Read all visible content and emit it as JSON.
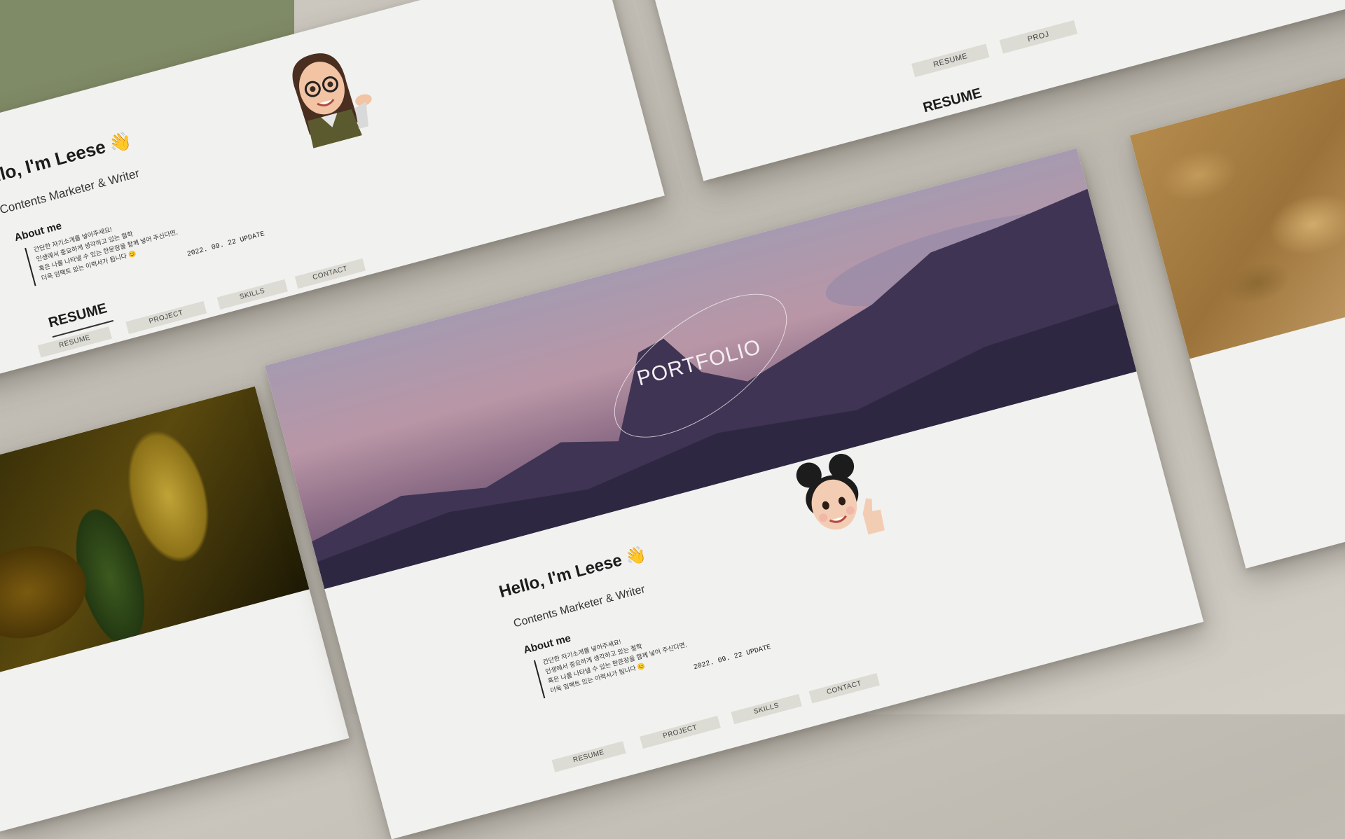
{
  "profile": {
    "greeting": "Hello, I'm Leese",
    "greeting_cut": "ello, I'm Leese",
    "wave_emoji": "👋",
    "role": "Contents Marketer & Writer",
    "about_title": "About me",
    "about_text": "간단한 자기소개를 넣어주세요!\n인생에서 중요하게 생각하고 있는 철학\n혹은 나를 나타낼 수 있는 한문장을 함께 넣어 주신다면,\n더욱 임팩트 있는 이력서가 됩니다 😊",
    "update": "2022. 09. 22  UPDATE"
  },
  "nav": {
    "resume": "RESUME",
    "project": "PROJECT",
    "skills": "SKILLS",
    "contact": "CONTACT",
    "project_cut": "PROJ"
  },
  "sections": {
    "resume_heading": "RESUME"
  },
  "banner": {
    "title": "PORTFOLIO"
  },
  "colors": {
    "accent_green": "#7f8a66",
    "button_bg": "#dcdcd4",
    "banner_purple": "#8c6c86"
  }
}
